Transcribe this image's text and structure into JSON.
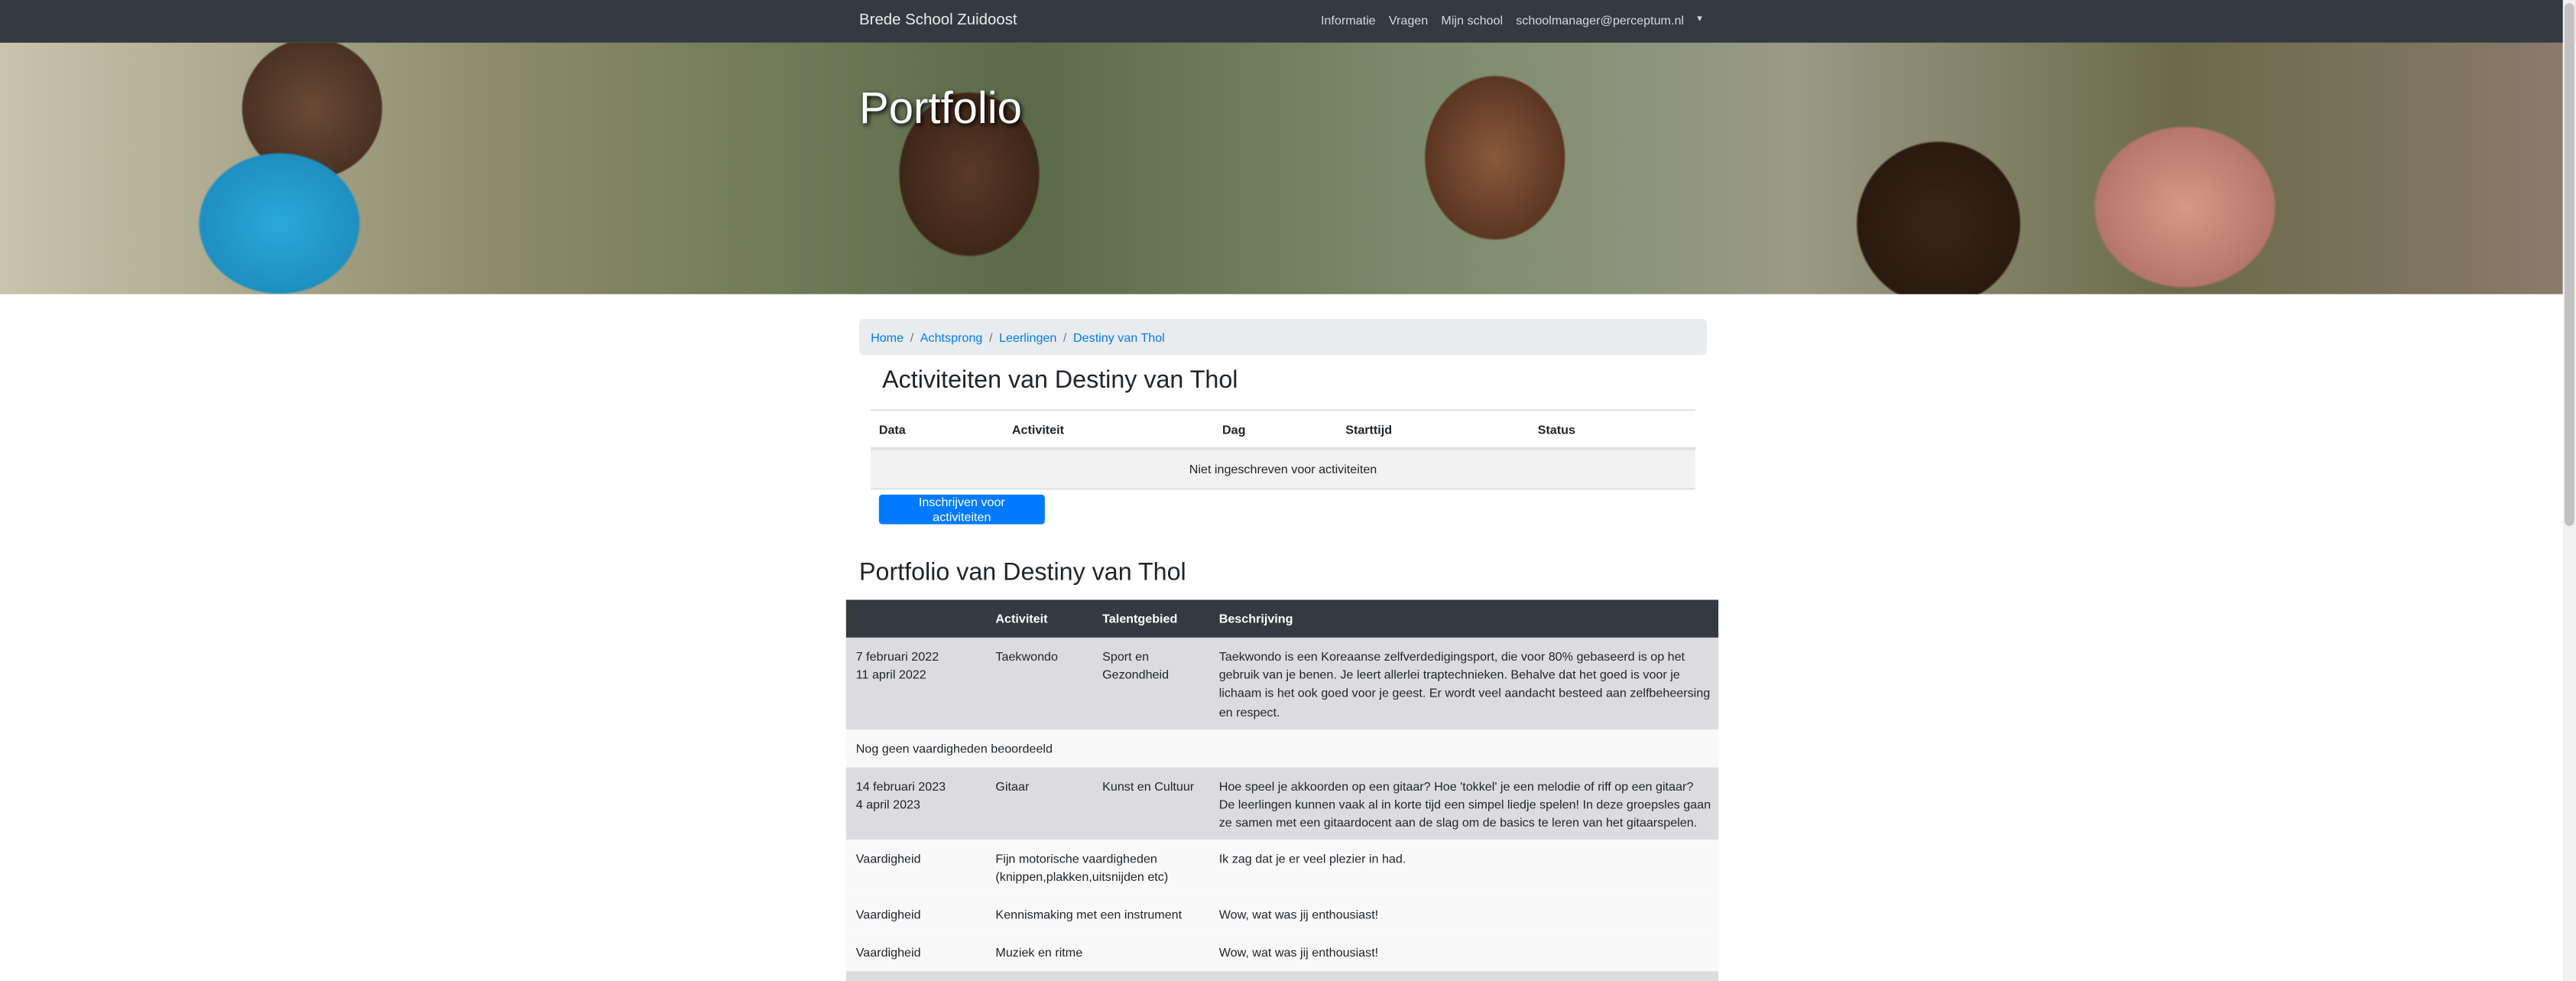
{
  "navbar": {
    "brand": "Brede School Zuidoost",
    "links": [
      "Informatie",
      "Vragen",
      "Mijn school",
      "schoolmanager@perceptum.nl"
    ],
    "caret": "▾"
  },
  "hero": {
    "title": "Portfolio"
  },
  "breadcrumb": [
    "Home",
    "Achtsprong",
    "Leerlingen",
    "Destiny van Thol"
  ],
  "activities": {
    "heading": "Activiteiten van Destiny van Thol",
    "columns": [
      "Data",
      "Activiteit",
      "Dag",
      "Starttijd",
      "Status"
    ],
    "empty_text": "Niet ingeschreven voor activiteiten",
    "button": "Inschrijven voor activiteiten"
  },
  "portfolio": {
    "heading": "Portfolio van Destiny van Thol",
    "columns": [
      "",
      "Activiteit",
      "Talentgebied",
      "Beschrijving"
    ],
    "entries": [
      {
        "date1": "7 februari 2022",
        "date2": "11 april 2022",
        "activity": "Taekwondo",
        "area_l1": "Sport en",
        "area_l2": "Gezondheid",
        "desc": "Taekwondo is een Koreaanse zelfverdedigingsport, die voor 80% gebaseerd is op het gebruik van je benen. Je leert allerlei traptechnieken. Behalve dat het goed is voor je lichaam is het ook goed voor je geest. Er wordt veel aandacht besteed aan zelfbeheersing en respect."
      },
      {
        "note": "Nog geen vaardigheden beoordeeld"
      },
      {
        "date1": "14 februari 2023",
        "date2": "4 april 2023",
        "activity": "Gitaar",
        "area_l1": "Kunst en Cultuur",
        "desc": "Hoe speel je akkoorden op een gitaar? Hoe 'tokkel' je een melodie of riff op een gitaar? De leerlingen kunnen vaak al in korte tijd een simpel liedje spelen! In deze groepsles gaan ze samen met een gitaardocent aan de slag om de basics te leren van het gitaarspelen."
      }
    ],
    "skills": [
      {
        "label": "Vaardigheid",
        "skill": "Fijn motorische vaardigheden (knippen,plakken,uitsnijden etc)",
        "comment": "Ik zag dat je er veel plezier in had."
      },
      {
        "label": "Vaardigheid",
        "skill": "Kennismaking met een instrument",
        "comment": "Wow, wat was jij enthousiast!"
      },
      {
        "label": "Vaardigheid",
        "skill": "Muziek en ritme",
        "comment": "Wow, wat was jij enthousiast!"
      }
    ]
  }
}
